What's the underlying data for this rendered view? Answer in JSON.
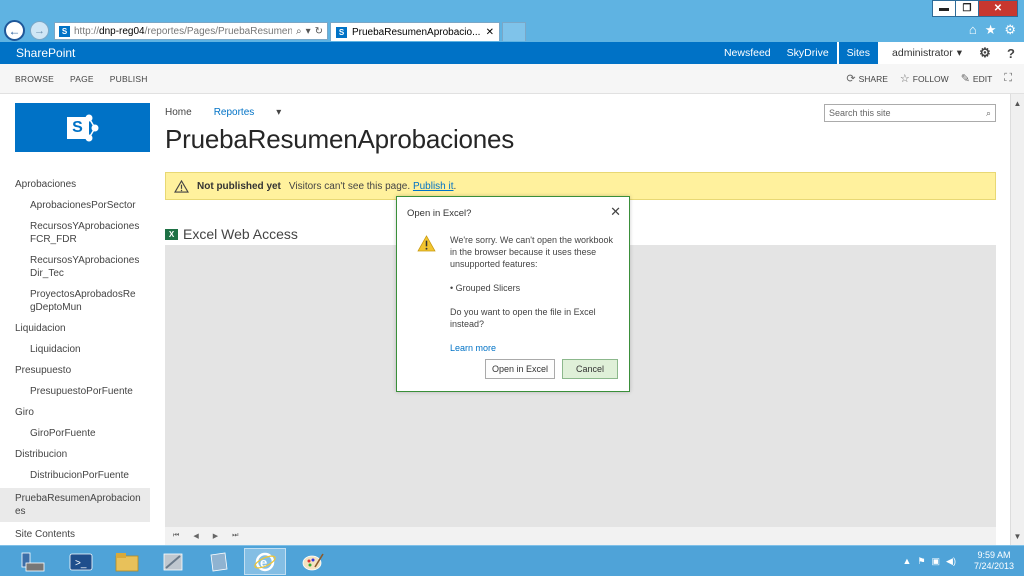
{
  "browser": {
    "window_controls": {
      "minimize": "▬",
      "restore": "❐",
      "close": "✕"
    },
    "url_prefix": "http://",
    "url_host": "dnp-reg04",
    "url_path": "/reportes/Pages/PruebaResumenApr",
    "tab_title": "PruebaResumenAprobacio...",
    "icons": [
      "back-icon",
      "forward-icon",
      "search-icon",
      "refresh-icon",
      "home-icon",
      "favorites-icon",
      "tools-icon"
    ]
  },
  "suitebar": {
    "brand": "SharePoint",
    "links": [
      "Newsfeed",
      "SkyDrive",
      "Sites"
    ],
    "user": "administrator",
    "help": "?"
  },
  "ribbon": {
    "tabs": [
      "BROWSE",
      "PAGE",
      "PUBLISH"
    ],
    "share": "SHARE",
    "follow": "FOLLOW",
    "edit": "EDIT"
  },
  "nav": {
    "items": [
      {
        "label": "Aprobaciones",
        "level": 0
      },
      {
        "label": "AprobacionesPorSector",
        "level": 1
      },
      {
        "label": "RecursosYAprobaciones FCR_FDR",
        "level": 1
      },
      {
        "label": "RecursosYAprobaciones Dir_Tec",
        "level": 1
      },
      {
        "label": "ProyectosAprobadosRegDeptoMun",
        "level": 1
      },
      {
        "label": "Liquidacion",
        "level": 0
      },
      {
        "label": "Liquidacion",
        "level": 1
      },
      {
        "label": "Presupuesto",
        "level": 0
      },
      {
        "label": "PresupuestoPorFuente",
        "level": 1
      },
      {
        "label": "Giro",
        "level": 0
      },
      {
        "label": "GiroPorFuente",
        "level": 1
      },
      {
        "label": "Distribucion",
        "level": 0
      },
      {
        "label": "DistribucionPorFuente",
        "level": 1
      },
      {
        "label": "PruebaResumenAprobaciones",
        "level": 0,
        "selected": true
      },
      {
        "label": "Site Contents",
        "level": 0
      }
    ]
  },
  "breadcrumb": {
    "home": "Home",
    "reportes": "Reportes"
  },
  "search": {
    "placeholder": "Search this site"
  },
  "page": {
    "title": "PruebaResumenAprobaciones"
  },
  "notice": {
    "bold": "Not published yet",
    "text": "Visitors can't see this page.",
    "link": "Publish it",
    "end": "."
  },
  "webpart": {
    "title": "Excel Web Access",
    "pager": [
      "⏮",
      "◀",
      "▶",
      "⏭"
    ]
  },
  "dialog": {
    "title": "Open in Excel?",
    "message": "We're sorry. We can't open the workbook in the browser because it uses these unsupported features:",
    "feature": "• Grouped Slicers",
    "question": "Do you want to open the file in Excel instead?",
    "learn_more": "Learn more",
    "open_btn": "Open in Excel",
    "cancel_btn": "Cancel"
  },
  "taskbar": {
    "time": "9:59 AM",
    "date": "7/24/2013",
    "apps": [
      "server-manager-icon",
      "powershell-icon",
      "file-explorer-icon",
      "tools-icon",
      "notepad-icon",
      "internet-explorer-icon",
      "paint-icon"
    ]
  },
  "colors": {
    "accent": "#0072c6",
    "notice_bg": "#fff19d",
    "taskbar": "#4fa3d8"
  }
}
